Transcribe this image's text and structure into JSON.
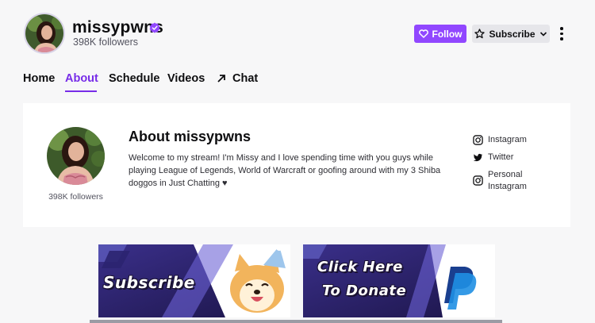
{
  "channel": {
    "name": "missypwns",
    "followers": "398K followers",
    "verified_icon": "verified-badge-icon",
    "accent_color": "#9147ff"
  },
  "header": {
    "follow_label": "Follow",
    "subscribe_label": "Subscribe",
    "icons": [
      "heart-icon",
      "star-icon",
      "chevron-down-icon",
      "more-vertical-icon"
    ]
  },
  "tabs": [
    {
      "label": "Home",
      "active": false
    },
    {
      "label": "About",
      "active": true
    },
    {
      "label": "Schedule",
      "active": false
    },
    {
      "label": "Videos",
      "active": false
    },
    {
      "label": "Chat",
      "active": false,
      "icon": "arrow-up-right-icon"
    }
  ],
  "about": {
    "title": "About missypwns",
    "description": "Welcome to my stream! I'm Missy and I love spending time with you guys while playing League of Legends, World of Warcraft or goofing around with my 3 Shiba doggos in Just Chatting ♥",
    "followers": "398K followers",
    "social": [
      {
        "label": "Instagram",
        "icon": "instagram-icon"
      },
      {
        "label": "Twitter",
        "icon": "twitter-icon"
      },
      {
        "label": "Personal Instagram",
        "icon": "instagram-icon"
      }
    ]
  },
  "panels": [
    {
      "label": "Subscribe",
      "image": "shiba-party-hat"
    },
    {
      "line1": "Click Here",
      "line2": "To Donate",
      "image": "paypal-logo"
    }
  ]
}
